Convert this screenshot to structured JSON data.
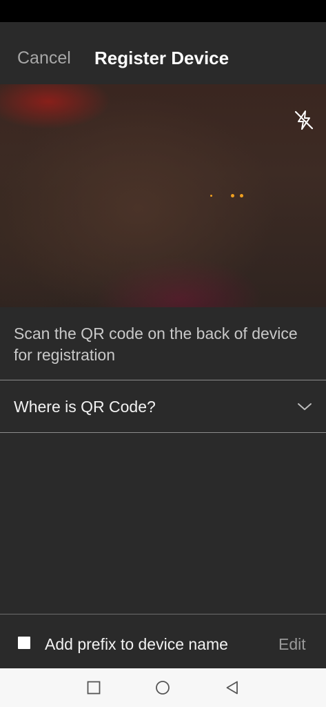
{
  "header": {
    "cancel_label": "Cancel",
    "title": "Register Device"
  },
  "camera": {
    "flash_icon": "flash-off-icon"
  },
  "instruction": "Scan the QR code on the back of device for registration",
  "qr_help": {
    "label": "Where is QR Code?",
    "icon": "chevron-down-icon"
  },
  "footer": {
    "checkbox_checked": false,
    "prefix_label": "Add prefix to device name",
    "edit_label": "Edit"
  },
  "nav": {
    "recents_icon": "square-icon",
    "home_icon": "circle-icon",
    "back_icon": "triangle-back-icon"
  },
  "colors": {
    "background": "#2a2a2a",
    "status_bar": "#000000",
    "nav_bar": "#f7f7f7",
    "focus_dot": "#f0a020",
    "muted_text": "#a8a8a8"
  }
}
